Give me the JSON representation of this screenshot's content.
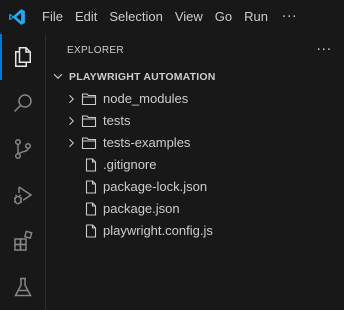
{
  "menubar": {
    "logo_icon": "vscode-logo-icon",
    "items": [
      "File",
      "Edit",
      "Selection",
      "View",
      "Go",
      "Run"
    ],
    "more_label": "···"
  },
  "activitybar": {
    "items": [
      {
        "icon": "explorer-icon",
        "active": true
      },
      {
        "icon": "search-icon",
        "active": false
      },
      {
        "icon": "source-control-icon",
        "active": false
      },
      {
        "icon": "run-debug-icon",
        "active": false
      },
      {
        "icon": "extensions-icon",
        "active": false
      },
      {
        "icon": "testing-icon",
        "active": false
      }
    ]
  },
  "sidebar": {
    "title": "EXPLORER",
    "more_label": "···",
    "section": {
      "title": "PLAYWRIGHT AUTOMATION",
      "expanded": true
    },
    "tree": [
      {
        "name": "node_modules",
        "type": "folder"
      },
      {
        "name": "tests",
        "type": "folder"
      },
      {
        "name": "tests-examples",
        "type": "folder"
      },
      {
        "name": ".gitignore",
        "type": "file"
      },
      {
        "name": "package-lock.json",
        "type": "file"
      },
      {
        "name": "package.json",
        "type": "file"
      },
      {
        "name": "playwright.config.js",
        "type": "file"
      }
    ]
  },
  "colors": {
    "background": "#181818",
    "foreground": "#cccccc",
    "accent": "#0078d4",
    "vscode_blue": "#23a9f2"
  }
}
